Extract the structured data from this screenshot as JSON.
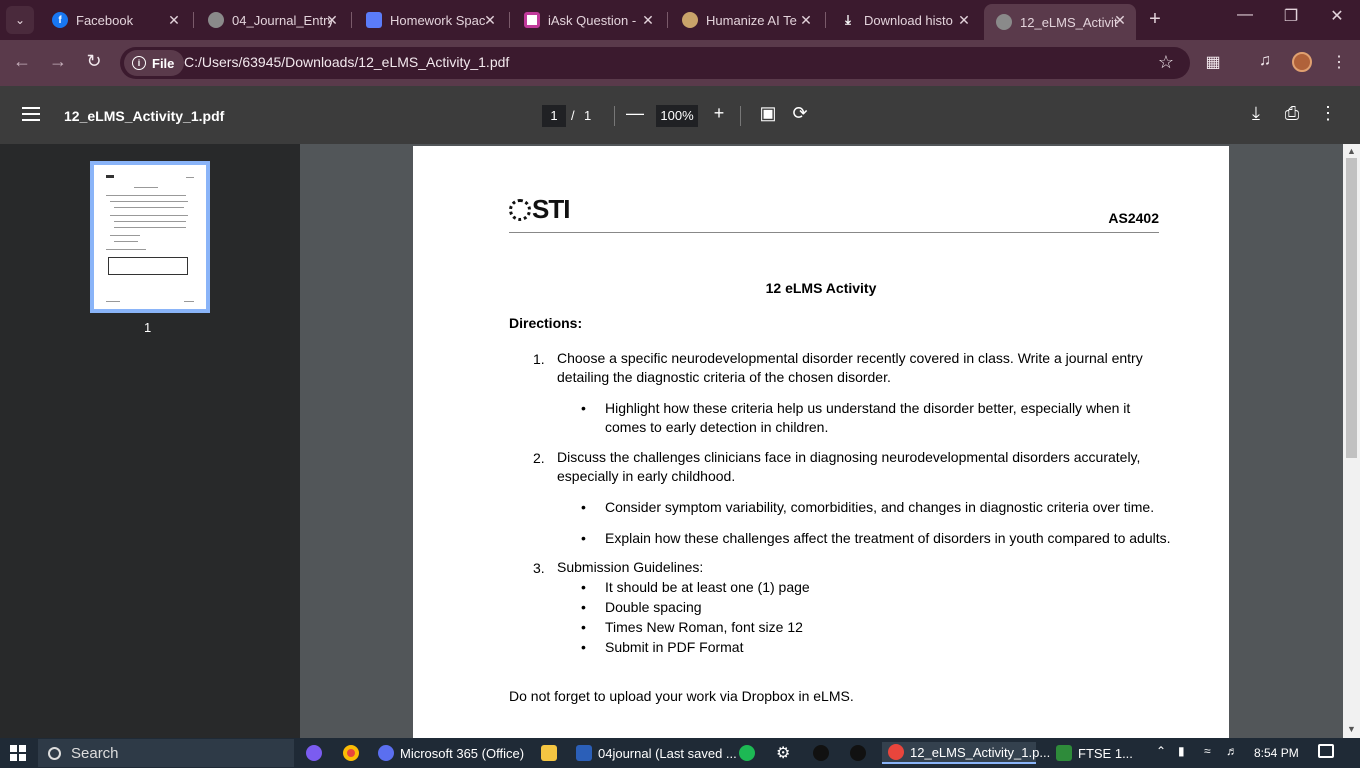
{
  "browser": {
    "tabs": [
      {
        "label": "Facebook",
        "icon": "facebook-icon",
        "color": "#1877f2"
      },
      {
        "label": "04_Journal_Entry",
        "icon": "globe-icon",
        "color": "#8a8a8a"
      },
      {
        "label": "Homework Spac",
        "icon": "cube-icon",
        "color": "#5b7cfa"
      },
      {
        "label": "iAsk Question - ",
        "icon": "iask-icon",
        "color": "#c0399a"
      },
      {
        "label": "Humanize AI Te",
        "icon": "humanize-icon",
        "color": "#c9a36a"
      },
      {
        "label": "Download histo",
        "icon": "download-icon",
        "color": "#e3d3db"
      },
      {
        "label": "12_eLMS_Activit",
        "icon": "globe-icon",
        "color": "#8a8a8a"
      }
    ],
    "address": {
      "chip": "File",
      "url": "C:/Users/63945/Downloads/12_eLMS_Activity_1.pdf"
    }
  },
  "pdf_viewer": {
    "file_name": "12_eLMS_Activity_1.pdf",
    "current_page": "1",
    "separator": "/",
    "total_pages": "1",
    "zoom": "100%",
    "thumbnail_label": "1"
  },
  "document": {
    "logo_text": "STI",
    "code": "AS2402",
    "title": "12 eLMS Activity",
    "directions_label": "Directions:",
    "items": [
      {
        "number": "1.",
        "line1": "Choose a specific neurodevelopmental disorder recently covered in class. Write a journal entry",
        "line2": "detailing the diagnostic criteria of the chosen disorder.",
        "bullets": [
          {
            "line1": "Highlight how these criteria help us understand the disorder better, especially when it",
            "line2": "comes to early detection in children."
          }
        ]
      },
      {
        "number": "2.",
        "line1": "Discuss the challenges clinicians face in diagnosing neurodevelopmental disorders accurately,",
        "line2": "especially in early childhood.",
        "bullets": [
          {
            "line1": "Consider symptom variability, comorbidities, and changes in diagnostic criteria over time."
          },
          {
            "line1": "Explain how these challenges affect the treatment of disorders in youth compared to adults."
          }
        ]
      },
      {
        "number": "3.",
        "line1": "Submission Guidelines:",
        "bullets": [
          {
            "line1": "It should be at least one (1) page"
          },
          {
            "line1": "Double spacing"
          },
          {
            "line1": "Times New Roman, font size 12"
          },
          {
            "line1": "Submit in PDF Format"
          }
        ]
      }
    ],
    "footer_note": "Do not forget to upload your work via Dropbox in eLMS."
  },
  "taskbar": {
    "search_label": "Search",
    "apps": [
      {
        "label": "Microsoft 365 (Office)"
      },
      {
        "label": "04journal (Last saved ..."
      },
      {
        "label": "12_eLMS_Activity_1.p..."
      },
      {
        "label": "FTSE 1..."
      }
    ],
    "clock": "8:54 PM"
  }
}
